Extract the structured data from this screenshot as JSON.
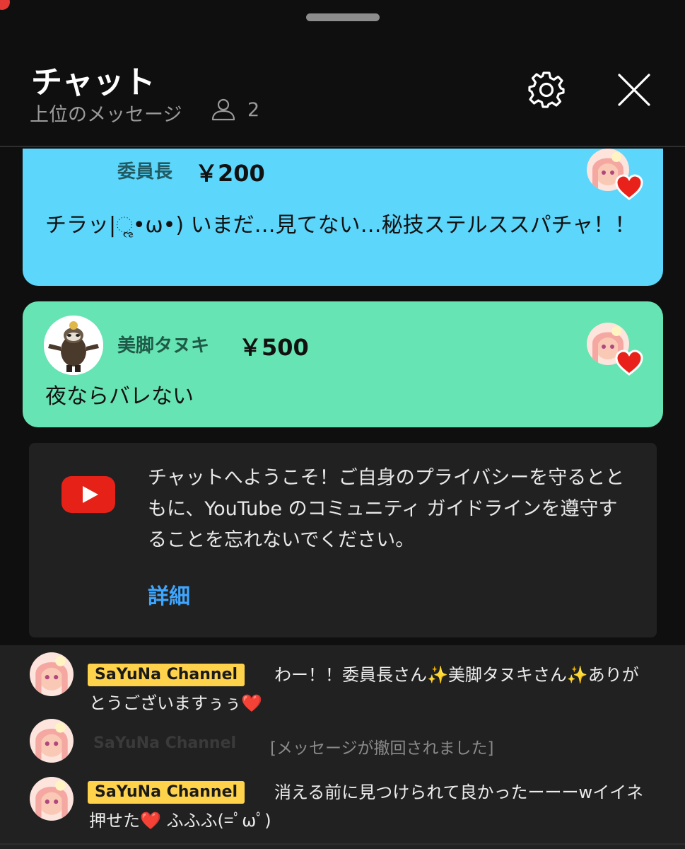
{
  "header": {
    "title": "チャット",
    "subtitle": "上位のメッセージ",
    "viewer_count": "2"
  },
  "icons": {
    "settings": "gear-icon",
    "close": "close-icon",
    "viewers": "person-icon",
    "heart": "heart-icon",
    "youtube": "youtube-logo"
  },
  "superchats": [
    {
      "author": "委員長",
      "amount": "￥200",
      "text": "チラッ|ૢ•ω•) いまだ…見てない…秘技ステルススパチャ！！",
      "color": "#5cd6fb"
    },
    {
      "author": "美脚タヌキ",
      "amount": "￥500",
      "text": "夜ならバレない",
      "color": "#67e4b3"
    }
  ],
  "welcome": {
    "text": "チャットへようこそ！ご自身のプライバシーを守るとともに、YouTube のコミュニティ ガイドラインを遵守することを忘れないでください。",
    "link": "詳細"
  },
  "messages": [
    {
      "author": "SaYuNa Channel",
      "text": "わー！！委員長さん✨美脚タヌキさん✨ありがとうございますぅぅ❤️"
    },
    {
      "author": "SaYuNa Channel",
      "text": "[メッセージが撤回されました]",
      "retracted": true
    },
    {
      "author": "SaYuNa Channel",
      "text": "消える前に見つけられて良かったーーーwイイネ押せた❤️ ふふふ(=ﾟωﾟ)"
    }
  ],
  "colors": {
    "background": "#0f0f0f",
    "owner_badge": "#ffd24b",
    "link": "#3ea6ff"
  }
}
